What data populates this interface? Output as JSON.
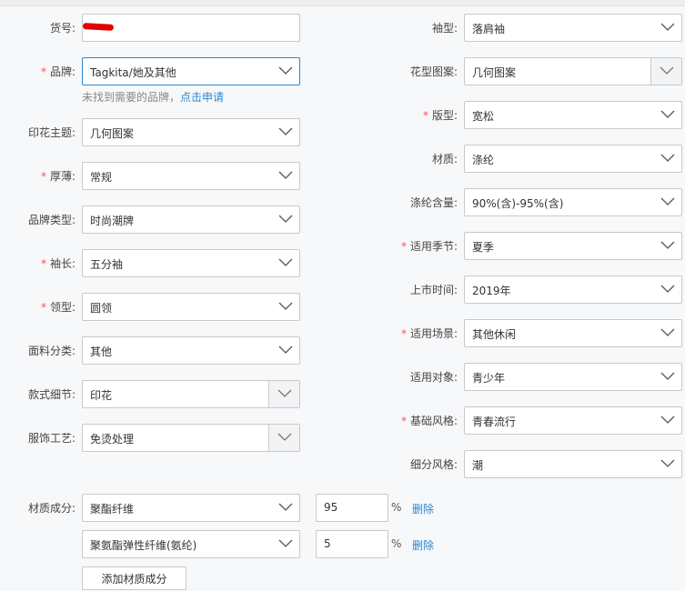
{
  "left_fields": [
    {
      "label": "货号",
      "required": false,
      "value": "",
      "kind": "input"
    },
    {
      "label": "品牌",
      "required": true,
      "value": "Tagkita/她及其他",
      "kind": "select"
    },
    {
      "label": "印花主题",
      "required": false,
      "value": "几何图案",
      "kind": "select"
    },
    {
      "label": "厚薄",
      "required": true,
      "value": "常规",
      "kind": "select"
    },
    {
      "label": "品牌类型",
      "required": false,
      "value": "时尚潮牌",
      "kind": "select"
    },
    {
      "label": "袖长",
      "required": true,
      "value": "五分袖",
      "kind": "select"
    },
    {
      "label": "领型",
      "required": true,
      "value": "圆领",
      "kind": "select"
    },
    {
      "label": "面料分类",
      "required": false,
      "value": "其他",
      "kind": "select"
    },
    {
      "label": "款式细节",
      "required": false,
      "value": "印花",
      "kind": "select-box"
    },
    {
      "label": "服饰工艺",
      "required": false,
      "value": "免烫处理",
      "kind": "select-box"
    }
  ],
  "brand_hint": {
    "text": "未找到需要的品牌，",
    "link": "点击申请"
  },
  "right_fields": [
    {
      "label": "袖型",
      "required": false,
      "value": "落肩袖",
      "kind": "select"
    },
    {
      "label": "花型图案",
      "required": false,
      "value": "几何图案",
      "kind": "select-box"
    },
    {
      "label": "版型",
      "required": true,
      "value": "宽松",
      "kind": "select"
    },
    {
      "label": "材质",
      "required": false,
      "value": "涤纶",
      "kind": "select"
    },
    {
      "label": "涤纶含量",
      "required": false,
      "value": "90%(含)-95%(含)",
      "kind": "select"
    },
    {
      "label": "适用季节",
      "required": true,
      "value": "夏季",
      "kind": "select"
    },
    {
      "label": "上市时间",
      "required": false,
      "value": "2019年",
      "kind": "select"
    },
    {
      "label": "适用场景",
      "required": true,
      "value": "其他休闲",
      "kind": "select"
    },
    {
      "label": "适用对象",
      "required": false,
      "value": "青少年",
      "kind": "select"
    },
    {
      "label": "基础风格",
      "required": true,
      "value": "青春流行",
      "kind": "select"
    },
    {
      "label": "细分风格",
      "required": false,
      "value": "潮",
      "kind": "select"
    }
  ],
  "material": {
    "label": "材质成分",
    "rows": [
      {
        "material": "聚酯纤维",
        "percent": "95",
        "unit": "%",
        "delete": "删除"
      },
      {
        "material": "聚氨酯弹性纤维(氨纶)",
        "percent": "5",
        "unit": "%",
        "delete": "删除"
      }
    ],
    "add_button": "添加材质成分"
  }
}
